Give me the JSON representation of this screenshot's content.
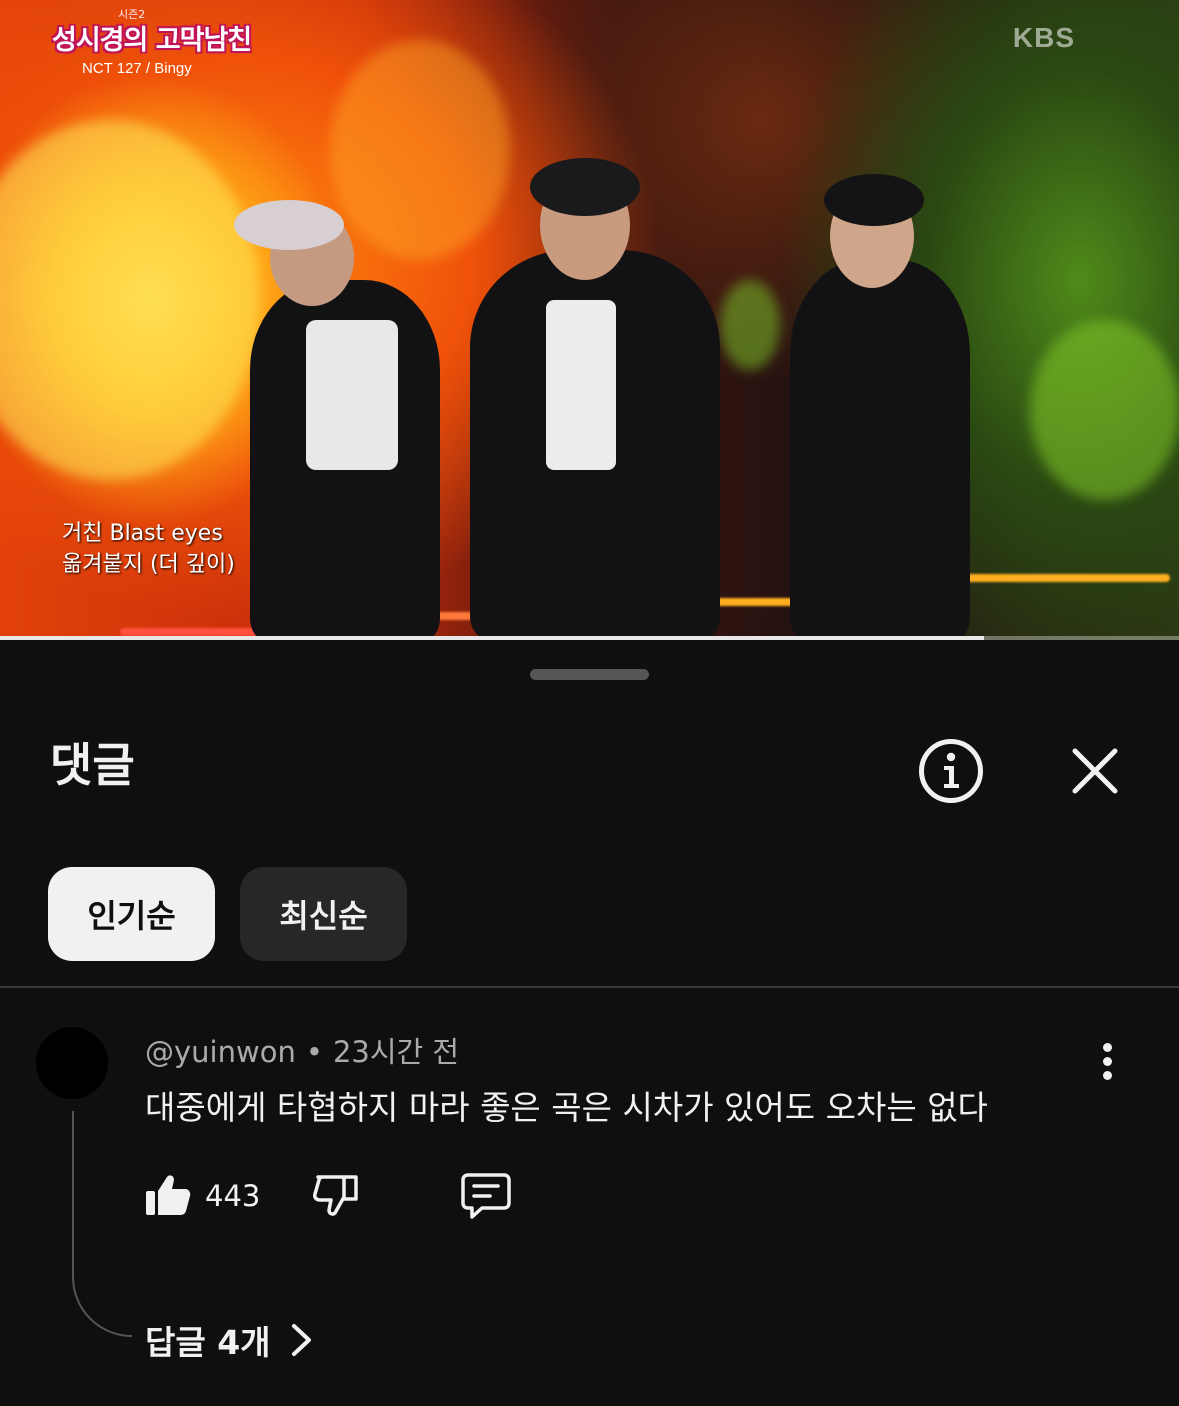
{
  "video": {
    "show_logo_top": "시즌2",
    "show_logo": "성시경의 고막남친",
    "show_subtitle": "NCT 127 / Bingy",
    "broadcaster": "KBS",
    "lyrics": [
      "거친 Blast eyes",
      "옮겨붙지 (더 깊이)"
    ],
    "progress_fraction": 0.835
  },
  "sheet": {
    "title": "댓글",
    "info_icon": "info-icon",
    "close_icon": "close-icon",
    "sort_chips": [
      {
        "label": "인기순",
        "active": true
      },
      {
        "label": "최신순",
        "active": false
      }
    ]
  },
  "comment": {
    "author": "@yuinwon",
    "separator": "•",
    "time": "23시간 전",
    "text": "대중에게 타협하지 마라 좋은 곡은 시차가 있어도 오차는 없다",
    "like_count": "443",
    "replies_label": "답글 4개",
    "icons": [
      "thumbs-up-icon",
      "thumbs-down-icon",
      "reply-icon",
      "more-vert-icon",
      "chevron-right-icon"
    ]
  },
  "colors": {
    "background": "#0f0f0f",
    "chip_active_bg": "#f1f1f1",
    "chip_idle_bg": "#272727",
    "secondary_text": "#aaaaaa"
  }
}
